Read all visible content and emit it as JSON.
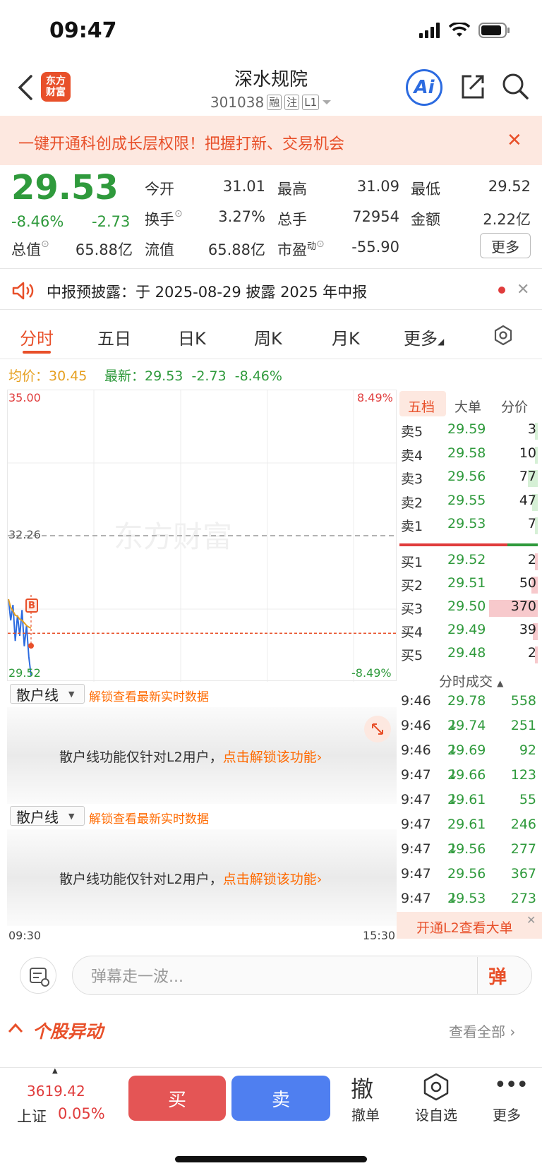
{
  "status_bar": {
    "time": "09:47"
  },
  "header": {
    "logo_text_top": "东方",
    "logo_text_bottom": "财富",
    "stock_name": "深水规院",
    "stock_code": "301038",
    "tags": [
      "融",
      "注",
      "L1"
    ],
    "ai_label": "Ai"
  },
  "promo": {
    "text": "一键开通科创成长层权限！把握打新、交易机会",
    "close": "✕"
  },
  "quote": {
    "last_price": "29.53",
    "pct_change": "-8.46%",
    "abs_change": "-2.73",
    "fields": {
      "open_label": "今开",
      "open": "31.01",
      "high_label": "最高",
      "high": "31.09",
      "low_label": "最低",
      "low": "29.52",
      "turnover_label": "换手",
      "turnover": "3.27%",
      "volume_label": "总手",
      "volume": "72954",
      "amount_label": "金额",
      "amount": "2.22亿",
      "mktcap_label": "总值",
      "mktcap": "65.88亿",
      "float_label": "流值",
      "float": "65.88亿",
      "pe_label": "市盈",
      "pe_sup": "动",
      "pe": "-55.90"
    },
    "more_label": "更多"
  },
  "notice": {
    "text": "中报预披露：于 2025-08-29 披露 2025 年中报"
  },
  "tabs": [
    "分时",
    "五日",
    "日K",
    "周K",
    "月K",
    "更多"
  ],
  "info_line": {
    "avg_label": "均价：30.45",
    "latest_label": "最新：29.53  -2.73  -8.46%"
  },
  "chart": {
    "y_top": "35.00",
    "y_mid": "32.26",
    "y_bottom": "29.52",
    "pct_top": "8.49%",
    "pct_bottom": "-8.49%",
    "time_start": "09:30",
    "time_end": "15:30",
    "watermark": "东方财富",
    "marker": "B"
  },
  "chart_data": {
    "type": "line",
    "ylim": [
      29.52,
      35.0
    ],
    "reference_price": 32.26,
    "series": [
      {
        "values": [
          31.01,
          30.6,
          30.9,
          30.2,
          30.7,
          30.3,
          30.8,
          30.1,
          30.5,
          29.9,
          29.53
        ]
      },
      {
        "values": [
          31.01,
          30.85,
          30.78,
          30.7,
          30.68,
          30.62,
          30.6,
          30.55,
          30.5,
          30.47,
          30.45
        ]
      }
    ]
  },
  "order_book": {
    "tabs": [
      "五档",
      "大单",
      "分价"
    ],
    "asks": [
      {
        "label": "卖5",
        "price": "29.59",
        "qty": "3",
        "bar": 0.02
      },
      {
        "label": "卖4",
        "price": "29.58",
        "qty": "10",
        "bar": 0.03
      },
      {
        "label": "卖3",
        "price": "29.56",
        "qty": "77",
        "bar": 0.2
      },
      {
        "label": "卖2",
        "price": "29.55",
        "qty": "47",
        "bar": 0.12
      },
      {
        "label": "卖1",
        "price": "29.53",
        "qty": "7",
        "bar": 0.02
      }
    ],
    "bids": [
      {
        "label": "买1",
        "price": "29.52",
        "qty": "2",
        "bar": 0.01
      },
      {
        "label": "买2",
        "price": "29.51",
        "qty": "50",
        "bar": 0.13
      },
      {
        "label": "买3",
        "price": "29.50",
        "qty": "370",
        "bar": 0.99
      },
      {
        "label": "买4",
        "price": "29.49",
        "qty": "39",
        "bar": 0.1
      },
      {
        "label": "买5",
        "price": "29.48",
        "qty": "2",
        "bar": 0.01
      }
    ],
    "ticks_title": "分时成交",
    "ticks": [
      {
        "time": "9:46",
        "price": "29.78",
        "qty": "558",
        "dir": ""
      },
      {
        "time": "9:46",
        "price": "29.74",
        "qty": "251",
        "dir": "↓"
      },
      {
        "time": "9:46",
        "price": "29.69",
        "qty": "92",
        "dir": "↓"
      },
      {
        "time": "9:47",
        "price": "29.66",
        "qty": "123",
        "dir": "↓"
      },
      {
        "time": "9:47",
        "price": "29.61",
        "qty": "55",
        "dir": "↓"
      },
      {
        "time": "9:47",
        "price": "29.61",
        "qty": "246",
        "dir": ""
      },
      {
        "time": "9:47",
        "price": "29.56",
        "qty": "277",
        "dir": "↓"
      },
      {
        "time": "9:47",
        "price": "29.56",
        "qty": "367",
        "dir": ""
      },
      {
        "time": "9:47",
        "price": "29.53",
        "qty": "273",
        "dir": "↓"
      }
    ],
    "l2_label": "开通L2查看大单"
  },
  "sub_panels": {
    "dropdown_label": "散户线",
    "unlock_hint": "解锁查看最新实时数据",
    "panel_text": "散户线功能仅针对L2用户，",
    "panel_link": "点击解锁该功能"
  },
  "danmu": {
    "placeholder": "弹幕走一波...",
    "button": "弹"
  },
  "anomaly": {
    "title": "个股异动",
    "view_all": "查看全部"
  },
  "bottom_bar": {
    "index_value": "3619.42",
    "index_name": "上证",
    "index_change": "0.05%",
    "buy": "买",
    "sell": "卖",
    "cancel_big": "撤",
    "cancel": "撤单",
    "watchlist": "设自选",
    "more": "更多"
  },
  "colors": {
    "up": "#e03c3c",
    "down": "#2f9a3c",
    "brand": "#e8502a",
    "avg": "#e6a020",
    "price_line": "#2c6be0"
  }
}
